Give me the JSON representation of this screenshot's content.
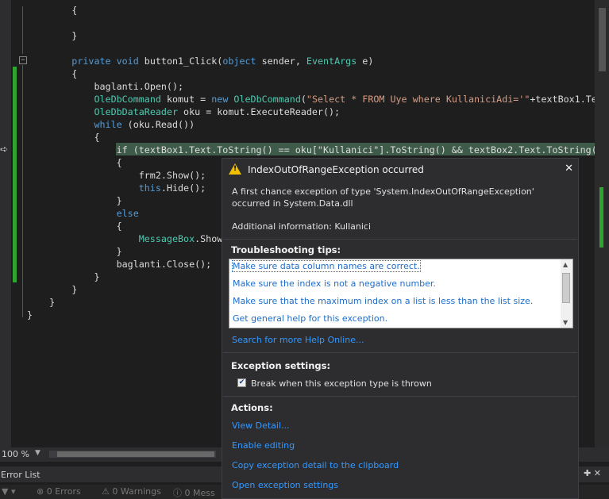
{
  "code": [
    {
      "indent": "        ",
      "parts": [
        {
          "t": "{",
          "c": ""
        }
      ]
    },
    {
      "indent": "",
      "parts": [
        {
          "t": "",
          "c": ""
        }
      ]
    },
    {
      "indent": "        ",
      "parts": [
        {
          "t": "}",
          "c": ""
        }
      ]
    },
    {
      "indent": "",
      "parts": [
        {
          "t": "",
          "c": ""
        }
      ]
    },
    {
      "indent": "        ",
      "parts": [
        {
          "t": "private",
          "c": "kw"
        },
        {
          "t": " ",
          "c": ""
        },
        {
          "t": "void",
          "c": "kw"
        },
        {
          "t": " button1_Click(",
          "c": ""
        },
        {
          "t": "object",
          "c": "kw"
        },
        {
          "t": " sender, ",
          "c": ""
        },
        {
          "t": "EventArgs",
          "c": "ty"
        },
        {
          "t": " e)",
          "c": ""
        }
      ]
    },
    {
      "indent": "        ",
      "parts": [
        {
          "t": "{",
          "c": ""
        }
      ]
    },
    {
      "indent": "            ",
      "parts": [
        {
          "t": "baglanti.Open();",
          "c": ""
        }
      ]
    },
    {
      "indent": "            ",
      "parts": [
        {
          "t": "OleDbCommand",
          "c": "ty"
        },
        {
          "t": " komut = ",
          "c": ""
        },
        {
          "t": "new",
          "c": "kw"
        },
        {
          "t": " ",
          "c": ""
        },
        {
          "t": "OleDbCommand",
          "c": "ty"
        },
        {
          "t": "(",
          "c": ""
        },
        {
          "t": "\"Select * FROM Uye where KullaniciAdi='\"",
          "c": "str"
        },
        {
          "t": "+textBox1.Te",
          "c": ""
        }
      ]
    },
    {
      "indent": "            ",
      "parts": [
        {
          "t": "OleDbDataReader",
          "c": "ty"
        },
        {
          "t": " oku = komut.ExecuteReader();",
          "c": ""
        }
      ]
    },
    {
      "indent": "            ",
      "parts": [
        {
          "t": "while",
          "c": "kw"
        },
        {
          "t": " (oku.Read())",
          "c": ""
        }
      ]
    },
    {
      "indent": "            ",
      "parts": [
        {
          "t": "{",
          "c": ""
        }
      ]
    },
    {
      "indent": "                ",
      "parts": [
        {
          "t": "if (textBox1.Text.ToString() == oku[\"Kullanici\"].ToString() && textBox2.Text.ToString(",
          "c": ""
        }
      ]
    },
    {
      "indent": "                ",
      "parts": [
        {
          "t": "{",
          "c": ""
        }
      ]
    },
    {
      "indent": "                    ",
      "parts": [
        {
          "t": "frm2.Show();",
          "c": ""
        }
      ]
    },
    {
      "indent": "                    ",
      "parts": [
        {
          "t": "this",
          "c": "kw"
        },
        {
          "t": ".Hide();",
          "c": ""
        }
      ]
    },
    {
      "indent": "                ",
      "parts": [
        {
          "t": "}",
          "c": ""
        }
      ]
    },
    {
      "indent": "                ",
      "parts": [
        {
          "t": "else",
          "c": "kw"
        }
      ]
    },
    {
      "indent": "                ",
      "parts": [
        {
          "t": "{",
          "c": ""
        }
      ]
    },
    {
      "indent": "                    ",
      "parts": [
        {
          "t": "MessageBox",
          "c": "ty"
        },
        {
          "t": ".Show",
          "c": ""
        }
      ]
    },
    {
      "indent": "                ",
      "parts": [
        {
          "t": "}",
          "c": ""
        }
      ]
    },
    {
      "indent": "                ",
      "parts": [
        {
          "t": "baglanti.Close();",
          "c": ""
        }
      ]
    },
    {
      "indent": "            ",
      "parts": [
        {
          "t": "}",
          "c": ""
        }
      ]
    },
    {
      "indent": "        ",
      "parts": [
        {
          "t": "}",
          "c": ""
        }
      ]
    },
    {
      "indent": "    ",
      "parts": [
        {
          "t": "}",
          "c": ""
        }
      ]
    },
    {
      "indent": "",
      "parts": [
        {
          "t": "}",
          "c": ""
        }
      ]
    }
  ],
  "status": {
    "zoom": "100 %",
    "error_list_title": "Error List",
    "errors": "0 Errors",
    "warnings": "0 Warnings",
    "messages": "0 Mess"
  },
  "exception": {
    "title": "IndexOutOfRangeException occurred",
    "message": "A first chance exception of type 'System.IndexOutOfRangeException' occurred in System.Data.dll",
    "additional_info": "Additional information: Kullanici",
    "troubleshooting_title": "Troubleshooting tips:",
    "tips": [
      "Make sure data column names are correct.",
      "Make sure the index is not a negative number.",
      "Make sure that the maximum index on a list is less than the list size.",
      "Get general help for this exception."
    ],
    "search_link": "Search for more Help Online...",
    "settings_title": "Exception settings:",
    "checkbox_label": "Break when this exception type is thrown",
    "checkbox_checked": true,
    "actions_title": "Actions:",
    "actions": [
      "View Detail...",
      "Enable editing",
      "Copy exception detail to the clipboard",
      "Open exception settings"
    ]
  }
}
